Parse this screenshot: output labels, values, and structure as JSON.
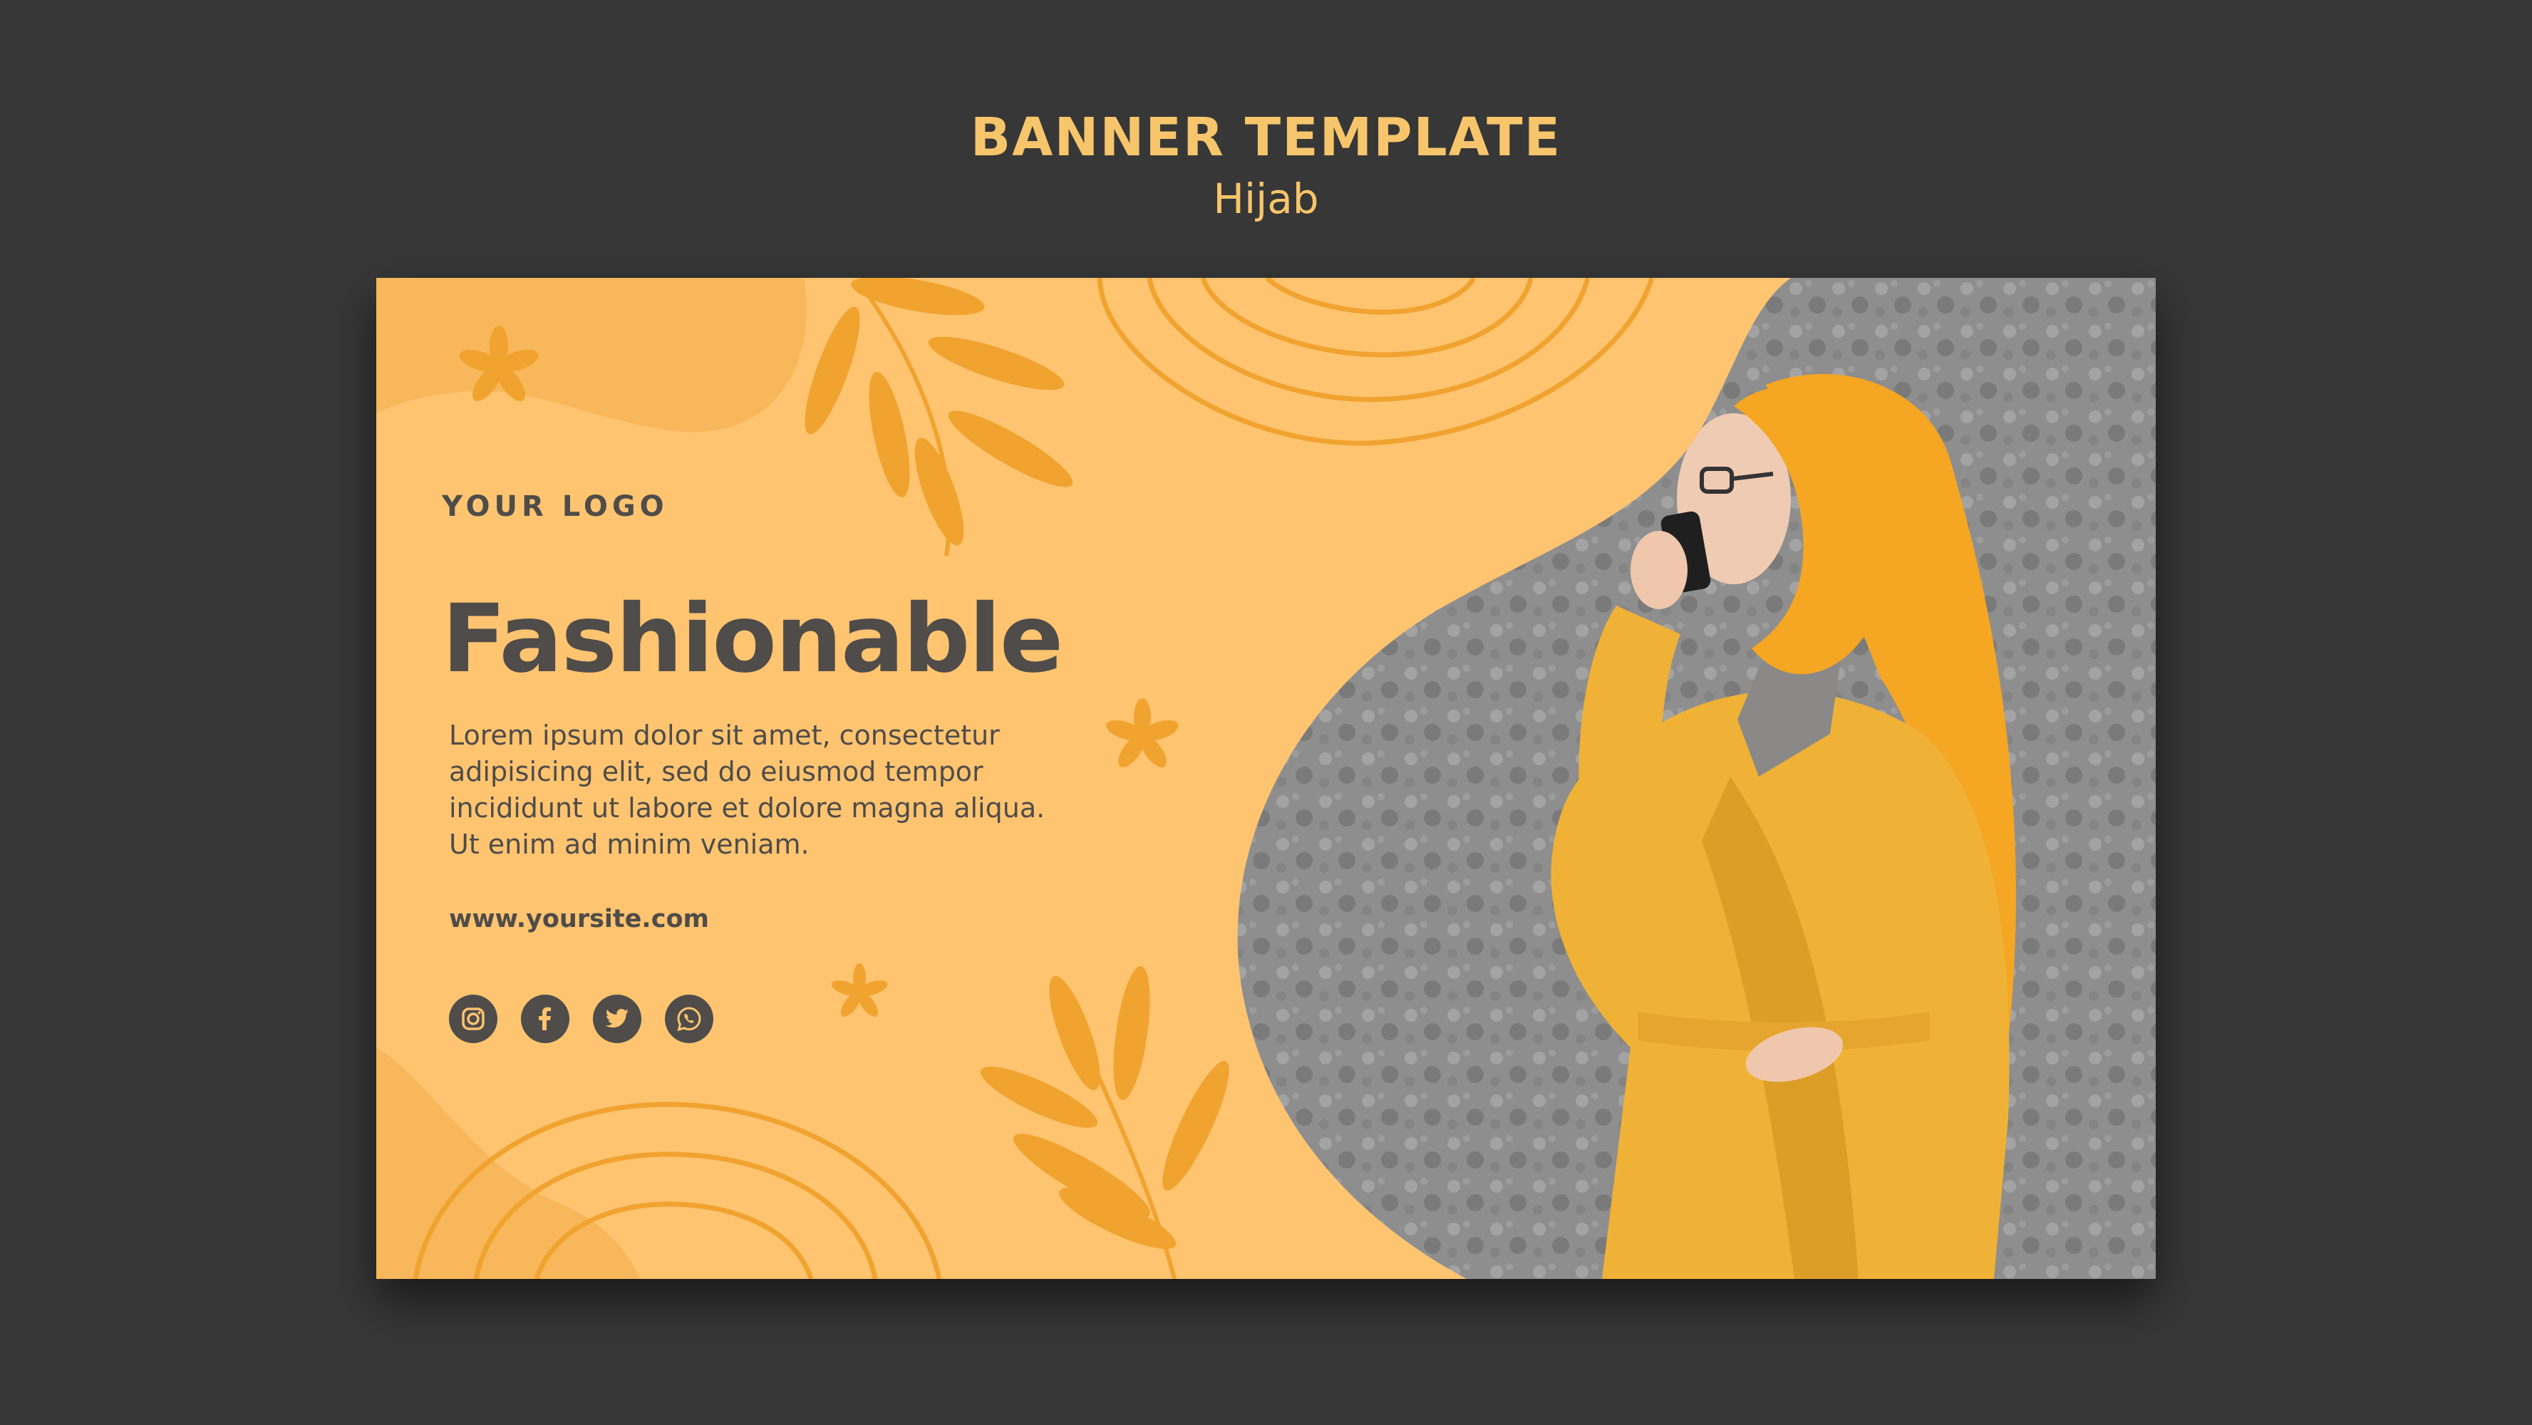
{
  "header": {
    "title": "BANNER TEMPLATE",
    "subtitle": "Hijab"
  },
  "banner": {
    "logo_text": "YOUR LOGO",
    "headline": "Fashionable",
    "body_lines": [
      "Lorem ipsum dolor sit amet, consectetur",
      "adipisicing elit, sed do eiusmod tempor",
      "incididunt ut labore et dolore magna aliqua.",
      "Ut enim ad minim veniam."
    ],
    "website": "www.yoursite.com",
    "social_icons": [
      "instagram-icon",
      "facebook-icon",
      "twitter-icon",
      "whatsapp-icon"
    ]
  },
  "colors": {
    "page_background": "#373737",
    "title_accent": "#f7c56b",
    "banner_background": "#fec470",
    "decor_orange": "#f1a330",
    "text_dark": "#4f4c49",
    "photo_wall": "#8a8a8a",
    "coat_yellow": "#f0b236",
    "scarf_orange": "#f5a623"
  }
}
